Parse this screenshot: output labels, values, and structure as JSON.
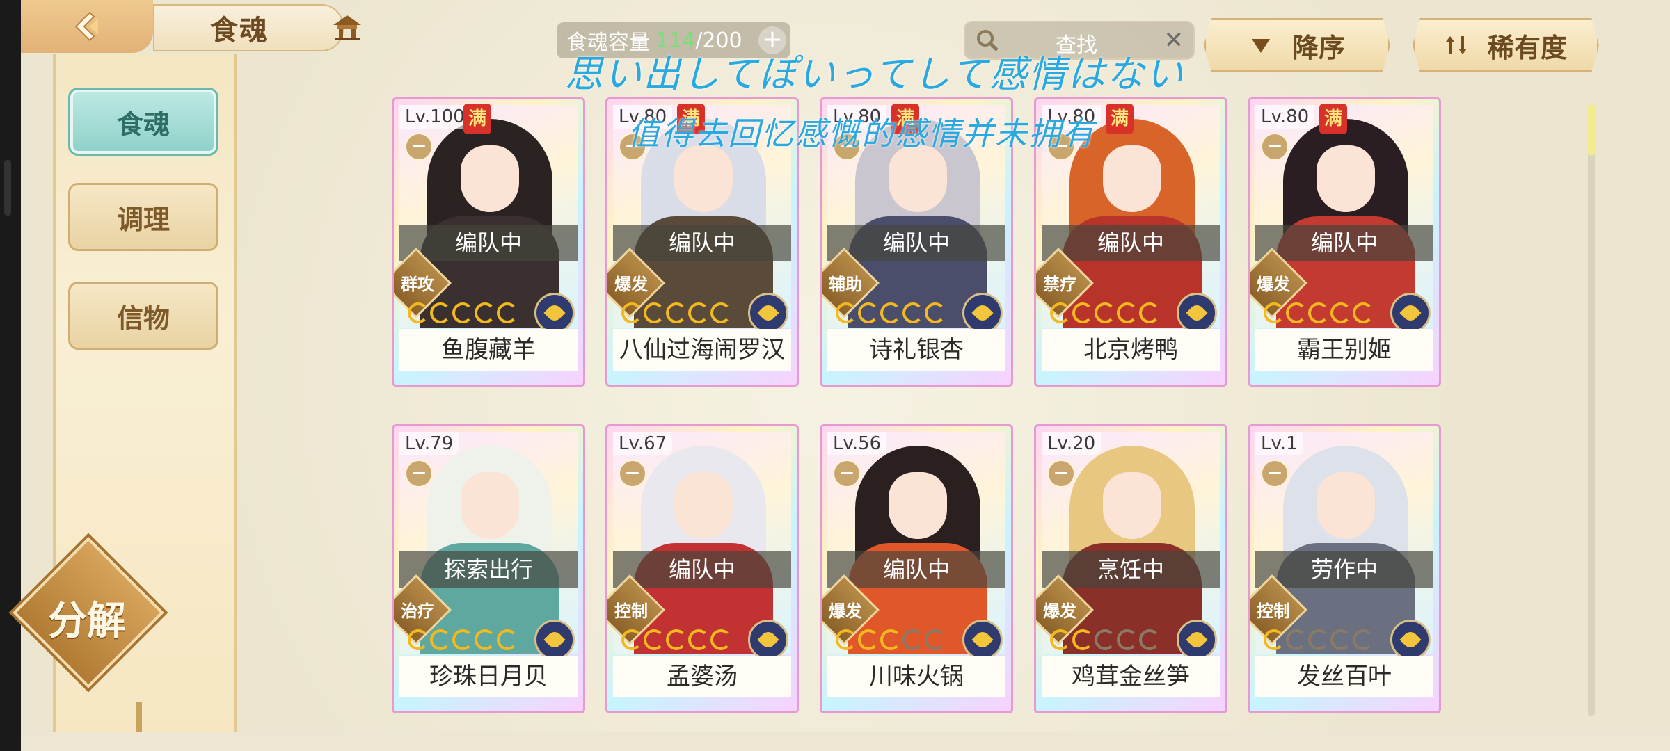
{
  "header": {
    "title": "食魂",
    "capacity_label": "食魂容量",
    "capacity_current": "114",
    "capacity_max": "/200",
    "capacity_add": "+",
    "search_placeholder": "查找",
    "search_clear": "✕",
    "sort_order_label": "降序",
    "sort_key_label": "稀有度"
  },
  "sidebar": {
    "tabs": [
      {
        "label": "食魂",
        "active": true
      },
      {
        "label": "调理",
        "active": false
      },
      {
        "label": "信物",
        "active": false
      }
    ],
    "decompose_label": "分解"
  },
  "overlay_text": {
    "line1": "思い出してぽいってして感情はない",
    "line2": "值得去回忆感慨的感情并未拥有"
  },
  "cards": [
    {
      "level": "Lv.100",
      "full": "满",
      "status": "编队中",
      "role": "群攻",
      "stars": 5,
      "name": "鱼腹藏羊",
      "hair": "#2b2222",
      "robe": "#3a3030"
    },
    {
      "level": "Lv.80",
      "full": "满",
      "status": "编队中",
      "role": "爆发",
      "stars": 5,
      "name": "八仙过海闹罗汉",
      "hair": "#d9dde8",
      "robe": "#5a4a3a"
    },
    {
      "level": "Lv.80",
      "full": "满",
      "status": "编队中",
      "role": "辅助",
      "stars": 5,
      "name": "诗礼银杏",
      "hair": "#c9c6cf",
      "robe": "#4a4e6a"
    },
    {
      "level": "Lv.80",
      "full": "满",
      "status": "编队中",
      "role": "禁疗",
      "stars": 5,
      "name": "北京烤鸭",
      "hair": "#d9642a",
      "robe": "#b8342a"
    },
    {
      "level": "Lv.80",
      "full": "满",
      "status": "编队中",
      "role": "爆发",
      "stars": 5,
      "name": "霸王别姬",
      "hair": "#2a1e22",
      "robe": "#c23a30"
    },
    {
      "level": "Lv.79",
      "full": "",
      "status": "探索出行",
      "role": "治疗",
      "stars": 5,
      "name": "珍珠日月贝",
      "hair": "#eef2ea",
      "robe": "#5fa8a0"
    },
    {
      "level": "Lv.67",
      "full": "",
      "status": "编队中",
      "role": "控制",
      "stars": 5,
      "name": "孟婆汤",
      "hair": "#e8e8ee",
      "robe": "#c23232"
    },
    {
      "level": "Lv.56",
      "full": "",
      "status": "编队中",
      "role": "爆发",
      "stars": 3,
      "name": "川味火锅",
      "hair": "#2a2020",
      "robe": "#e0582a"
    },
    {
      "level": "Lv.20",
      "full": "",
      "status": "烹饪中",
      "role": "爆发",
      "stars": 2,
      "name": "鸡茸金丝笋",
      "hair": "#e8c880",
      "robe": "#8a3028"
    },
    {
      "level": "Lv.1",
      "full": "",
      "status": "劳作中",
      "role": "控制",
      "stars": 1,
      "name": "发丝百叶",
      "hair": "#dde2ea",
      "robe": "#6a7080"
    }
  ],
  "icons": {
    "back": "back-arrow-icon",
    "pavilion": "pavilion-icon",
    "search": "magnifier-icon",
    "sort_desc": "triangle-down-icon",
    "sort_rarity": "sort-arrows-icon"
  },
  "colors": {
    "accent_teal": "#8dd1c9",
    "gold": "#d6a35a",
    "overlay_blue": "#2aa8e0"
  }
}
